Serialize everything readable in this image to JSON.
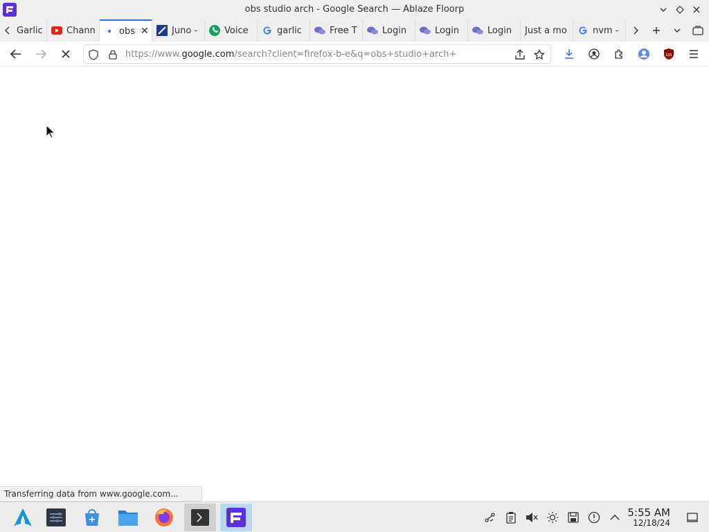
{
  "window": {
    "title": "obs studio arch - Google Search — Ablaze Floorp"
  },
  "tabs": [
    {
      "label": "Garlic",
      "icon": "chevron-left-icon"
    },
    {
      "label": "Chann",
      "icon": "youtube-icon"
    },
    {
      "label": "obs",
      "icon": "loading-dot-icon",
      "active": true
    },
    {
      "label": "Juno -",
      "icon": "juno-icon"
    },
    {
      "label": "Voice",
      "icon": "phone-icon"
    },
    {
      "label": "garlic",
      "icon": "google-icon"
    },
    {
      "label": "Free T",
      "icon": "chat-icon"
    },
    {
      "label": "Login",
      "icon": "chat-icon"
    },
    {
      "label": "Login",
      "icon": "chat-icon"
    },
    {
      "label": "Login",
      "icon": "chat-icon"
    },
    {
      "label": "Just a mo",
      "icon": ""
    },
    {
      "label": "nvm -",
      "icon": "google-icon"
    }
  ],
  "url": {
    "prefix": "https://www.",
    "host": "google.com",
    "suffix": "/search?client=firefox-b-e&q=obs+studio+arch+"
  },
  "status": {
    "text": "Transferring data from www.google.com..."
  },
  "taskbar": {
    "time": "5:55 AM",
    "date": "12/18/24"
  },
  "colors": {
    "accent": "#5b2ee0",
    "active_tab_border": "#3a6fd8",
    "ublock": "#8b0000"
  }
}
